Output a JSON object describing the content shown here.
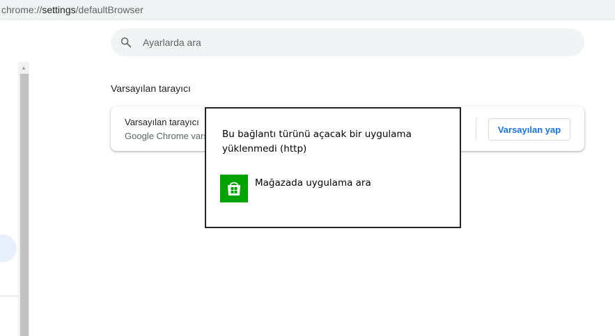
{
  "omnibox": {
    "url_scheme": "chrome://",
    "url_host": "settings",
    "url_path": "/defaultBrowser"
  },
  "search": {
    "placeholder": "Ayarlarda ara",
    "icon": "search-icon"
  },
  "section": {
    "title": "Varsayılan tarayıcı"
  },
  "card": {
    "title": "Varsayılan tarayıcı",
    "subtitle": "Google Chrome vars",
    "button_label": "Varsayılan yap"
  },
  "dialog": {
    "message": "Bu bağlantı türünü açacak bir uygulama yüklenmedi (http)",
    "store_link_label": "Mağazada uygulama ara",
    "store_icon": "store-bag-icon"
  },
  "colors": {
    "accent": "#1a73e8",
    "store_green": "#00a300"
  }
}
